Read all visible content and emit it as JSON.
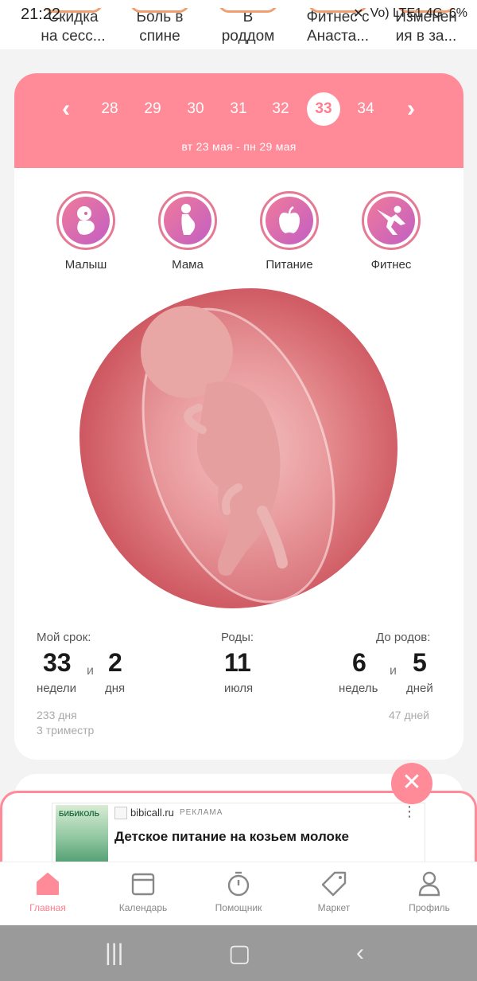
{
  "status_bar": {
    "time": "21:22",
    "network": "Vo) LTE1 4G",
    "battery": "6%"
  },
  "stories": [
    {
      "line1": "Скидка",
      "line2": "на сесс..."
    },
    {
      "line1": "Боль в",
      "line2": "спине"
    },
    {
      "line1": "В",
      "line2": "роддом"
    },
    {
      "line1": "Фитнес с",
      "line2": "Анаста..."
    },
    {
      "line1": "Изменен",
      "line2": "ия в за..."
    }
  ],
  "week_selector": {
    "weeks": [
      "28",
      "29",
      "30",
      "31",
      "32",
      "33",
      "34"
    ],
    "active_week": "33",
    "prev_icon": "chevron-left-icon",
    "next_icon": "chevron-right-icon",
    "date_range": "вт 23 мая - пн 29 мая"
  },
  "categories": [
    {
      "label": "Малыш",
      "icon": "baby-icon"
    },
    {
      "label": "Мама",
      "icon": "pregnant-woman-icon"
    },
    {
      "label": "Питание",
      "icon": "apple-icon"
    },
    {
      "label": "Фитнес",
      "icon": "yoga-pose-icon"
    }
  ],
  "term": {
    "label": "Мой срок:",
    "weeks": "33",
    "weeks_unit": "недели",
    "conj": "и",
    "days": "2",
    "days_unit": "дня",
    "total_days": "233 дня",
    "trimester": "3 триместр"
  },
  "birth": {
    "label": "Роды:",
    "day": "11",
    "month": "июля"
  },
  "until_birth": {
    "label": "До родов:",
    "weeks": "6",
    "weeks_unit": "недель",
    "conj": "и",
    "days": "5",
    "days_unit": "дней",
    "total_days": "47 дней"
  },
  "ad": {
    "brand_text": "БИБИКОЛЬ",
    "domain": "bibicall.ru",
    "tag": "РЕКЛАМА",
    "title": "Детское питание на козьем молоке",
    "more_icon": "more-vertical-icon",
    "close_icon": "close-icon"
  },
  "tabs": [
    {
      "label": "Главная",
      "icon": "home-icon",
      "active": true
    },
    {
      "label": "Календарь",
      "icon": "calendar-icon",
      "active": false
    },
    {
      "label": "Помощник",
      "icon": "timer-icon",
      "active": false
    },
    {
      "label": "Маркет",
      "icon": "tag-icon",
      "active": false
    },
    {
      "label": "Профиль",
      "icon": "profile-icon",
      "active": false
    }
  ],
  "colors": {
    "accent": "#ff8a98",
    "accent_text": "#ff7d8e",
    "category_ring": "#e47a96"
  }
}
